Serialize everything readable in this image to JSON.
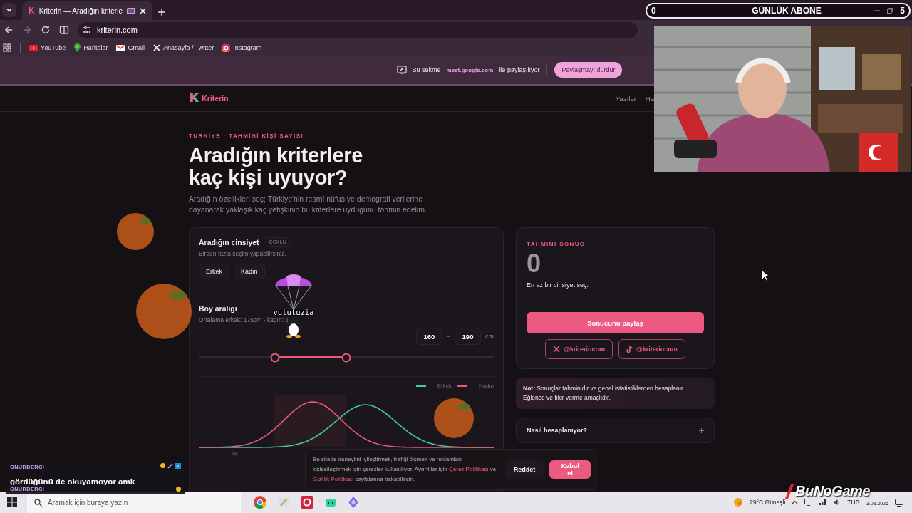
{
  "browser": {
    "tabs": [
      {
        "favicon": "K",
        "title": "Kriterin — Aradığın kriterle",
        "selected": true
      }
    ],
    "address": "kriterin.com",
    "bookmarks": [
      {
        "kind": "youtube",
        "label": "YouTube"
      },
      {
        "kind": "maps",
        "label": "Haritalar"
      },
      {
        "kind": "gmail",
        "label": "Gmail"
      },
      {
        "kind": "x",
        "label": "Anasayfa / Twitter"
      },
      {
        "kind": "instagram",
        "label": "Instagram"
      }
    ]
  },
  "share_bar": {
    "prefix": "Bu sekme",
    "site": "meet.google.com",
    "suffix": "ile paylaşılıyor",
    "button": "Paylaşmayı durdur"
  },
  "site": {
    "logo_mark": "K",
    "brand": "Kriterin",
    "nav": [
      "Yazılar",
      "Ha"
    ]
  },
  "hero": {
    "eyebrow": "TÜRKİYE · TAHMİNİ KİŞİ SAYISI",
    "title_lines": [
      "Aradığın kriterlere",
      "kaç kişi uyuyor?"
    ],
    "intro": "Aradığın özellikleri seç; Türkiye'nin resmî nüfus ve demografi verilerine dayanarak yaklaşık kaç yetişkinin bu kriterlere uyduğunu tahmin edelim."
  },
  "form": {
    "gender": {
      "title": "Aradığın cinsiyet",
      "badge": "ÇOKLU",
      "hint": "Birden fazla seçim yapabilirsiniz.",
      "options": [
        {
          "label": "Erkek",
          "selected": false
        },
        {
          "label": "Kadın",
          "selected": false
        }
      ]
    },
    "height": {
      "title": "Boy aralığı",
      "hint": "Ortalama erkek: 175cm - kadın: 1",
      "min": "160",
      "separator": "–",
      "max": "190",
      "unit": "cm",
      "thumbs": [
        {
          "level": 0.258
        },
        {
          "level": 0.499
        }
      ],
      "legend": [
        {
          "label": "Erkek",
          "color": "#3ecf9e"
        },
        {
          "label": "Kadın",
          "color": "#e8587e"
        }
      ],
      "axis_label": "140"
    }
  },
  "result": {
    "label": "TAHMİNİ SONUÇ",
    "value": "0",
    "message": "En az bir cinsiyet seç.",
    "share": "Sonucunu paylaş",
    "socials": [
      {
        "kind": "x",
        "handle": "@kriterincom"
      },
      {
        "kind": "tiktok",
        "handle": "@kriterincom"
      }
    ]
  },
  "note": "**Not:** Sonuçlar tahminidir ve genel istatistiklerden hesaplanır. Eğlence ve fikir verme amaçlıdır.",
  "faq": [
    {
      "question": "Nasıl hesaplanıyor?",
      "expanded": false
    }
  ],
  "cookie": {
    "parts": [
      {
        "kind": "text",
        "text": "Bu sitede deneyimi iyileştirmek, trafiği ölçmek ve reklamları kişiselleştirmek için çerezler kullanılıyor. Ayrıntılar için "
      },
      {
        "kind": "link",
        "text": "Çerez Politikası"
      },
      {
        "kind": "text",
        "text": " ve "
      },
      {
        "kind": "link",
        "text": "Gizlilik Politikası"
      },
      {
        "kind": "text",
        "text": " sayfalarına bakabilirsin."
      }
    ],
    "reject": "Reddet",
    "accept": "Kabul et"
  },
  "taskbar": {
    "search_placeholder": "Aramak için buraya yazın",
    "weather": "29°C Güneşli",
    "language": "TUR",
    "date": "3.08.2026"
  },
  "stream_overlay": {
    "goal": {
      "current": "0",
      "title": "GÜNLÜK ABONE",
      "target": "5"
    },
    "chat": [
      {
        "user": "ONURDERCI",
        "message": "gördüğünü de okuyamoyor amk"
      },
      {
        "user": "ONURDERCI"
      }
    ],
    "sticker_name": "vututuzia",
    "logo": "BuNoGame"
  }
}
